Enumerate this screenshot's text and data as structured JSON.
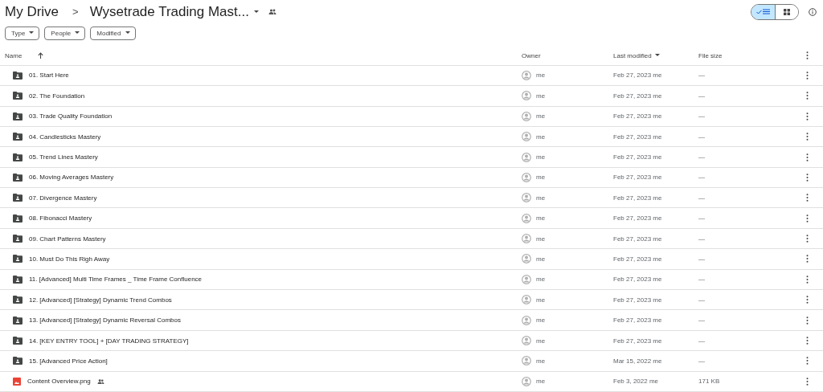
{
  "breadcrumb": {
    "root": "My Drive",
    "separator": ">",
    "current": "Wysetrade Trading Mast...",
    "shared": true
  },
  "view_toggle": [
    {
      "kind": "list",
      "selected": true
    },
    {
      "kind": "grid",
      "selected": false
    }
  ],
  "filters": [
    "Type",
    "People",
    "Modified"
  ],
  "table": {
    "columns": [
      {
        "label": "Name",
        "sorted": true,
        "ascending": true
      },
      {
        "label": "Owner",
        "sorted": false
      },
      {
        "label": "Last modified",
        "sorted": true,
        "ascending": false
      },
      {
        "label": "File size",
        "sorted": false
      }
    ],
    "rows": [
      {
        "kind": "folder",
        "name": "01. Start Here",
        "shared": false,
        "owner": "me",
        "modified": "Feb 27, 2023 me",
        "size": "—"
      },
      {
        "kind": "folder",
        "name": "02. The Foundation",
        "shared": false,
        "owner": "me",
        "modified": "Feb 27, 2023 me",
        "size": "—"
      },
      {
        "kind": "folder",
        "name": "03. Trade Quality Foundation",
        "shared": false,
        "owner": "me",
        "modified": "Feb 27, 2023 me",
        "size": "—"
      },
      {
        "kind": "folder",
        "name": "04. Candlesticks Mastery",
        "shared": false,
        "owner": "me",
        "modified": "Feb 27, 2023 me",
        "size": "—"
      },
      {
        "kind": "folder",
        "name": "05. Trend Lines Mastery",
        "shared": false,
        "owner": "me",
        "modified": "Feb 27, 2023 me",
        "size": "—"
      },
      {
        "kind": "folder",
        "name": "06. Moving Averages Mastery",
        "shared": false,
        "owner": "me",
        "modified": "Feb 27, 2023 me",
        "size": "—"
      },
      {
        "kind": "folder",
        "name": "07. Divergence Mastery",
        "shared": false,
        "owner": "me",
        "modified": "Feb 27, 2023 me",
        "size": "—"
      },
      {
        "kind": "folder",
        "name": "08. Fibonacci Mastery",
        "shared": false,
        "owner": "me",
        "modified": "Feb 27, 2023 me",
        "size": "—"
      },
      {
        "kind": "folder",
        "name": "09. Chart Patterns Mastery",
        "shared": false,
        "owner": "me",
        "modified": "Feb 27, 2023 me",
        "size": "—"
      },
      {
        "kind": "folder",
        "name": "10. Must Do This Righ Away",
        "shared": false,
        "owner": "me",
        "modified": "Feb 27, 2023 me",
        "size": "—"
      },
      {
        "kind": "folder",
        "name": "11. [Advanced] Multi Time Frames _ Time Frame Confluence",
        "shared": false,
        "owner": "me",
        "modified": "Feb 27, 2023 me",
        "size": "—"
      },
      {
        "kind": "folder",
        "name": "12. [Advanced] [Strategy] Dynamic Trend Combos",
        "shared": false,
        "owner": "me",
        "modified": "Feb 27, 2023 me",
        "size": "—"
      },
      {
        "kind": "folder",
        "name": "13. [Advanced] [Strategy] Dynamic Reversal Combos",
        "shared": false,
        "owner": "me",
        "modified": "Feb 27, 2023 me",
        "size": "—"
      },
      {
        "kind": "folder",
        "name": "14. [KEY ENTRY TOOL] + [DAY TRADING STRATEGY]",
        "shared": false,
        "owner": "me",
        "modified": "Feb 27, 2023 me",
        "size": "—"
      },
      {
        "kind": "folder",
        "name": "15. [Advanced Price Action]",
        "shared": false,
        "owner": "me",
        "modified": "Mar 15, 2022 me",
        "size": "—"
      },
      {
        "kind": "image",
        "name": "Content Overview.png",
        "shared": true,
        "owner": "me",
        "modified": "Feb 3, 2022 me",
        "size": "171 KB"
      }
    ]
  }
}
